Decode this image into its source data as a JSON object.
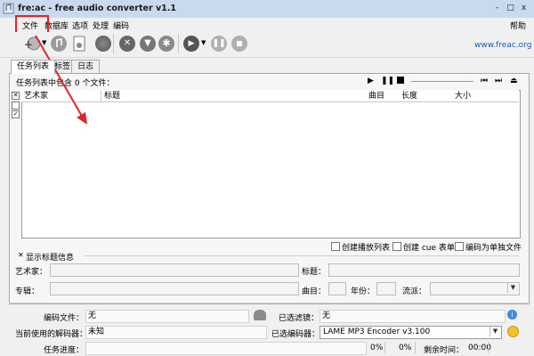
{
  "window": {
    "title": "fre:ac - free audio converter v1.1",
    "buttons": {
      "minimize": "-",
      "restore": "□",
      "close": "x"
    }
  },
  "menu": {
    "items": [
      "文件",
      "数据库",
      "选项",
      "处理",
      "编码"
    ],
    "help": "帮助"
  },
  "toolbar": {
    "website": "www.freac.org"
  },
  "tabs": [
    "任务列表",
    "标签",
    "日志"
  ],
  "joblist": {
    "status": "任务列表中包含 0 个文件：",
    "columns": [
      "艺术家",
      "标题",
      "曲目",
      "长度",
      "大小"
    ]
  },
  "options": {
    "create_playlist": "创建播放列表",
    "create_cue": "创建 cue 表单",
    "encode_single": "编码为单独文件"
  },
  "tag_info": {
    "toggle": "显示标题信息",
    "artist": "艺术家：",
    "title": "标题：",
    "album": "专辑：",
    "track": "曲目：",
    "year": "年份：",
    "genre": "流派："
  },
  "status": {
    "encoding_file_label": "编码文件：",
    "encoding_file_value": "无",
    "selected_filter_label": "已选滤镜：",
    "selected_filter_value": "无",
    "decoder_label": "当前使用的解码器：",
    "decoder_value": "未知",
    "encoder_label": "已选编码器：",
    "encoder_value": "LAME MP3 Encoder v3.100",
    "progress_label": "任务进度：",
    "progress_pct": "0%",
    "progress_total": "0%",
    "remaining_label": "剩余时间：",
    "remaining_value": "00:00"
  },
  "colors": {
    "highlight": "#e0262b",
    "link": "#1a5bb5",
    "titlebar": "#c9d9ee"
  }
}
